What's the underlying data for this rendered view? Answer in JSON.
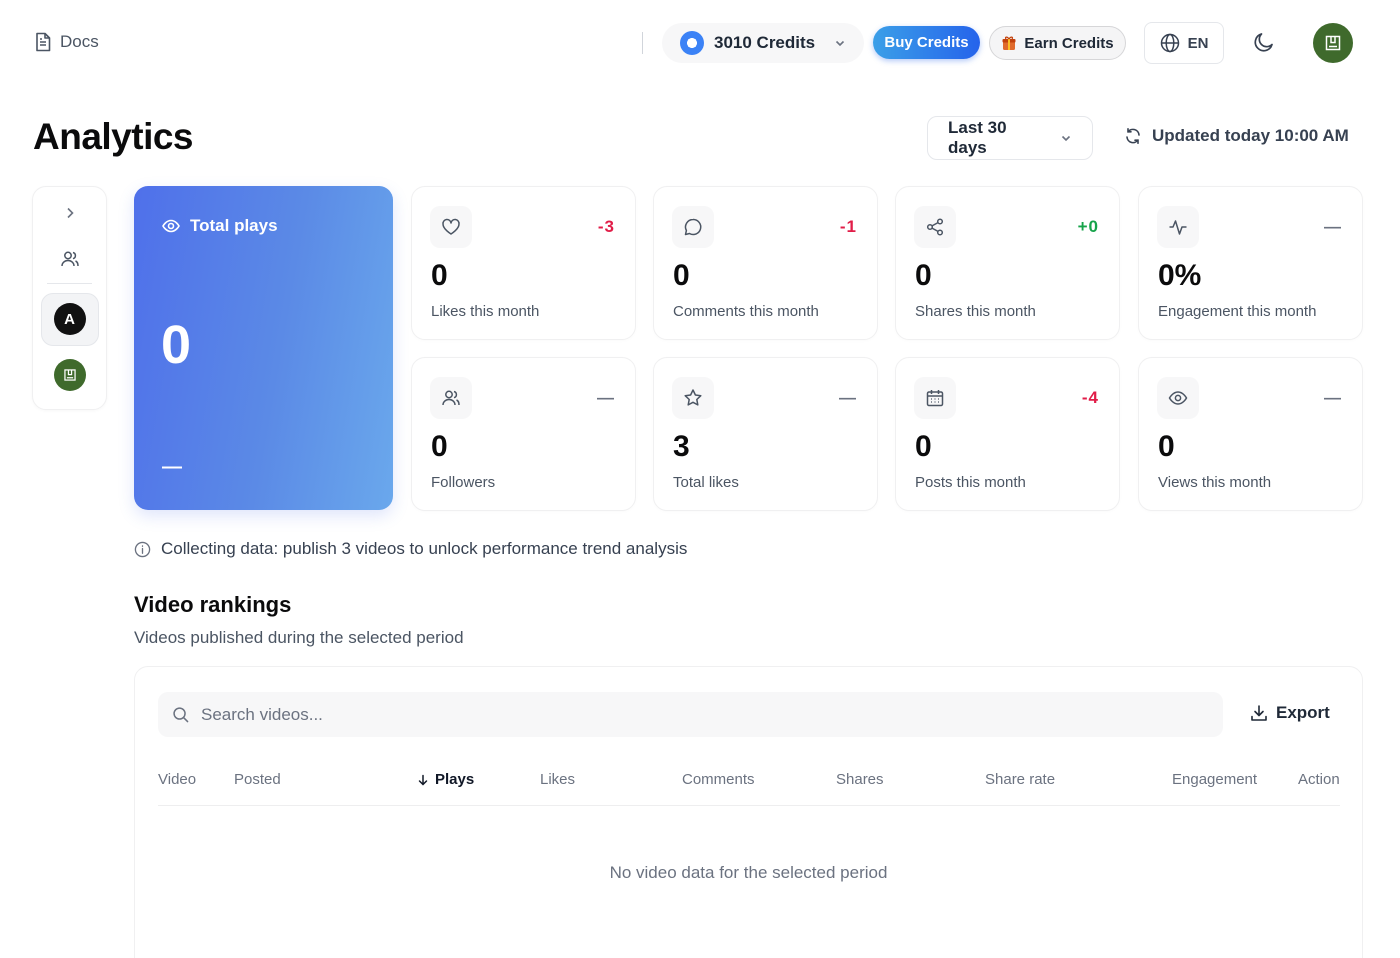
{
  "topbar": {
    "docs_label": "Docs",
    "credits_label": "3010 Credits",
    "buy_label": "Buy Credits",
    "earn_label": "Earn Credits",
    "lang_label": "EN"
  },
  "page": {
    "title": "Analytics",
    "range_label": "Last 30 days",
    "updated_label": "Updated today 10:00 AM"
  },
  "rail": {
    "avatar_letter": "A"
  },
  "hero": {
    "label": "Total plays",
    "value": "0",
    "change": "—"
  },
  "metrics": [
    {
      "icon": "heart-icon",
      "delta": "-3",
      "trend": "negative",
      "value": "0",
      "caption": "Likes this month"
    },
    {
      "icon": "comment-icon",
      "delta": "-1",
      "trend": "negative",
      "value": "0",
      "caption": "Comments this month"
    },
    {
      "icon": "share-icon",
      "delta": "+0",
      "trend": "positive",
      "value": "0",
      "caption": "Shares this month"
    },
    {
      "icon": "activity-icon",
      "delta": "—",
      "trend": "neutral",
      "value": "0%",
      "caption": "Engagement this month"
    },
    {
      "icon": "users-icon",
      "delta": "—",
      "trend": "neutral",
      "value": "0",
      "caption": "Followers"
    },
    {
      "icon": "star-icon",
      "delta": "—",
      "trend": "neutral",
      "value": "3",
      "caption": "Total likes"
    },
    {
      "icon": "calendar-icon",
      "delta": "-4",
      "trend": "negative",
      "value": "0",
      "caption": "Posts this month"
    },
    {
      "icon": "eye-icon",
      "delta": "—",
      "trend": "neutral",
      "value": "0",
      "caption": "Views this month"
    }
  ],
  "info_text": "Collecting data: publish 3 videos to unlock performance trend analysis",
  "rankings": {
    "title": "Video rankings",
    "subtitle": "Videos published during the selected period",
    "search_placeholder": "Search videos...",
    "export_label": "Export",
    "columns": [
      "Video",
      "Posted",
      "Plays",
      "Likes",
      "Comments",
      "Shares",
      "Share rate",
      "Engagement",
      "Action"
    ],
    "sorted_column": "Plays",
    "empty_text": "No video data for the selected period"
  },
  "colors": {
    "negative": "#e11d48",
    "positive": "#16a34a",
    "neutral": "#6b7280",
    "hero_gradient_start": "#4f70ea",
    "hero_gradient_end": "#6aa8ec",
    "buy_button": "#2563eb",
    "avatar_green": "#3f6a2c"
  }
}
